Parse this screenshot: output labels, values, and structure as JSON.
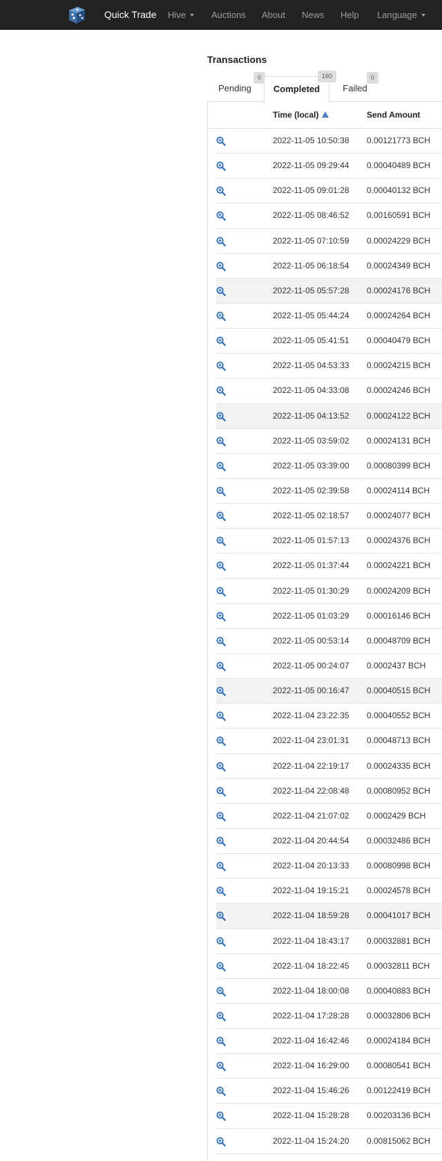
{
  "navbar": {
    "brand": "Quick Trade",
    "items": [
      {
        "label": "Hive",
        "dropdown": true
      },
      {
        "label": "Auctions",
        "dropdown": false
      },
      {
        "label": "About",
        "dropdown": false
      },
      {
        "label": "News",
        "dropdown": false
      },
      {
        "label": "Help",
        "dropdown": false
      },
      {
        "label": "Language",
        "dropdown": true
      }
    ]
  },
  "transactions": {
    "title": "Transactions",
    "tabs": [
      {
        "label": "Pending",
        "count": "0",
        "active": false
      },
      {
        "label": "Completed",
        "count": "160",
        "active": true
      },
      {
        "label": "Failed",
        "count": "0",
        "active": false
      }
    ],
    "columns": {
      "time": "Time (local)",
      "amount": "Send Amount"
    },
    "rows": [
      {
        "time": "2022-11-05 10:50:38",
        "amount": "0.00121773 BCH"
      },
      {
        "time": "2022-11-05 09:29:44",
        "amount": "0.00040489 BCH"
      },
      {
        "time": "2022-11-05 09:01:28",
        "amount": "0.00040132 BCH"
      },
      {
        "time": "2022-11-05 08:46:52",
        "amount": "0.00160591 BCH"
      },
      {
        "time": "2022-11-05 07:10:59",
        "amount": "0.00024229 BCH"
      },
      {
        "time": "2022-11-05 06:18:54",
        "amount": "0.00024349 BCH"
      },
      {
        "time": "2022-11-05 05:57:28",
        "amount": "0.00024176 BCH"
      },
      {
        "time": "2022-11-05 05:44:24",
        "amount": "0.00024264 BCH"
      },
      {
        "time": "2022-11-05 05:41:51",
        "amount": "0.00040479 BCH"
      },
      {
        "time": "2022-11-05 04:53:33",
        "amount": "0.00024215 BCH"
      },
      {
        "time": "2022-11-05 04:33:08",
        "amount": "0.00024246 BCH"
      },
      {
        "time": "2022-11-05 04:13:52",
        "amount": "0.00024122 BCH"
      },
      {
        "time": "2022-11-05 03:59:02",
        "amount": "0.00024131 BCH"
      },
      {
        "time": "2022-11-05 03:39:00",
        "amount": "0.00080399 BCH"
      },
      {
        "time": "2022-11-05 02:39:58",
        "amount": "0.00024114 BCH"
      },
      {
        "time": "2022-11-05 02:18:57",
        "amount": "0.00024077 BCH"
      },
      {
        "time": "2022-11-05 01:57:13",
        "amount": "0.00024376 BCH"
      },
      {
        "time": "2022-11-05 01:37:44",
        "amount": "0.00024221 BCH"
      },
      {
        "time": "2022-11-05 01:30:29",
        "amount": "0.00024209 BCH"
      },
      {
        "time": "2022-11-05 01:03:29",
        "amount": "0.00016146 BCH"
      },
      {
        "time": "2022-11-05 00:53:14",
        "amount": "0.00048709 BCH"
      },
      {
        "time": "2022-11-05 00:24:07",
        "amount": "0.0002437 BCH"
      },
      {
        "time": "2022-11-05 00:16:47",
        "amount": "0.00040515 BCH"
      },
      {
        "time": "2022-11-04 23:22:35",
        "amount": "0.00040552 BCH"
      },
      {
        "time": "2022-11-04 23:01:31",
        "amount": "0.00048713 BCH"
      },
      {
        "time": "2022-11-04 22:19:17",
        "amount": "0.00024335 BCH"
      },
      {
        "time": "2022-11-04 22:08:48",
        "amount": "0.00080952 BCH"
      },
      {
        "time": "2022-11-04 21:07:02",
        "amount": "0.0002429 BCH"
      },
      {
        "time": "2022-11-04 20:44:54",
        "amount": "0.00032486 BCH"
      },
      {
        "time": "2022-11-04 20:13:33",
        "amount": "0.00080998 BCH"
      },
      {
        "time": "2022-11-04 19:15:21",
        "amount": "0.00024578 BCH"
      },
      {
        "time": "2022-11-04 18:59:28",
        "amount": "0.00041017 BCH"
      },
      {
        "time": "2022-11-04 18:43:17",
        "amount": "0.00032881 BCH"
      },
      {
        "time": "2022-11-04 18:22:45",
        "amount": "0.00032811 BCH"
      },
      {
        "time": "2022-11-04 18:00:08",
        "amount": "0.00040883 BCH"
      },
      {
        "time": "2022-11-04 17:28:28",
        "amount": "0.00032806 BCH"
      },
      {
        "time": "2022-11-04 16:42:46",
        "amount": "0.00024184 BCH"
      },
      {
        "time": "2022-11-04 16:29:00",
        "amount": "0.00080541 BCH"
      },
      {
        "time": "2022-11-04 15:46:26",
        "amount": "0.00122419 BCH"
      },
      {
        "time": "2022-11-04 15:28:28",
        "amount": "0.00203136 BCH"
      },
      {
        "time": "2022-11-04 15:24:20",
        "amount": "0.00815062 BCH"
      }
    ]
  },
  "icons": {
    "row_icon": "zoom-in-icon",
    "sort_icon": "sort-ascending-icon",
    "logo": "dice-logo-icon"
  },
  "colors": {
    "navbar_bg": "#222222",
    "nav_text": "#9d9d9d",
    "brand_text": "#ffffff",
    "accent": "#4a7bbf",
    "row_highlight": "#f2f2f2"
  }
}
